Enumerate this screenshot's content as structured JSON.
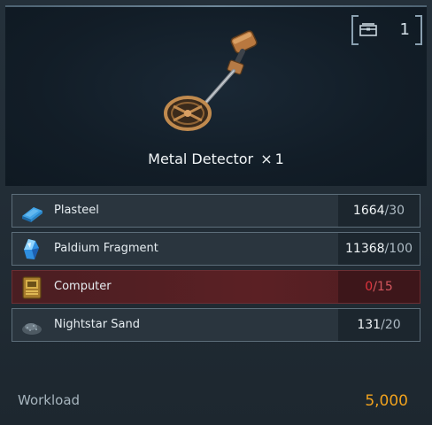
{
  "recipe": {
    "item_name": "Metal Detector",
    "multiplier_symbol": "×",
    "quantity": "1",
    "owned_count": "1",
    "owned_icon": "storage-box-icon"
  },
  "materials": [
    {
      "name": "Plasteel",
      "have": "1664",
      "need": "30",
      "icon": "plasteel-ingot-icon",
      "sufficient": true
    },
    {
      "name": "Paldium Fragment",
      "have": "11368",
      "need": "100",
      "icon": "paldium-crystal-icon",
      "sufficient": true
    },
    {
      "name": "Computer",
      "have": "0",
      "need": "15",
      "icon": "computer-chip-icon",
      "sufficient": false
    },
    {
      "name": "Nightstar Sand",
      "have": "131",
      "need": "20",
      "icon": "sand-pile-icon",
      "sufficient": true
    }
  ],
  "workload": {
    "label": "Workload",
    "value": "5,000"
  },
  "colors": {
    "accent_orange": "#f0a21e",
    "missing_red": "#e0333d"
  },
  "separator": "/"
}
